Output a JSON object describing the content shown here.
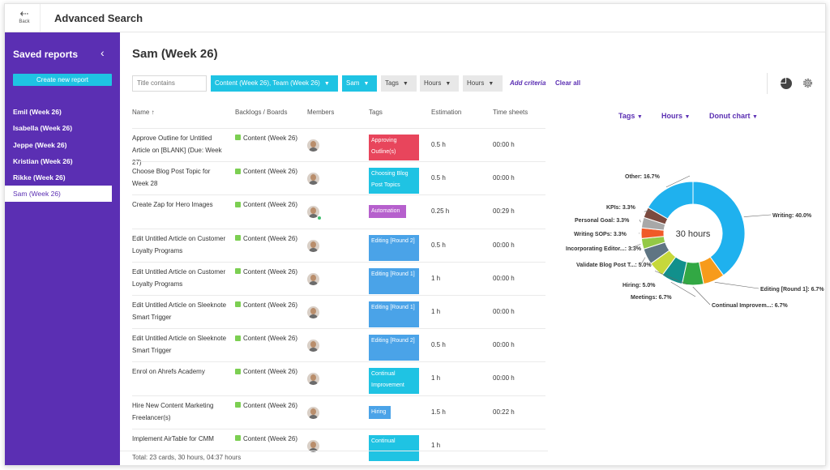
{
  "topbar": {
    "back_label": "Back",
    "title": "Advanced Search"
  },
  "sidebar": {
    "title": "Saved reports",
    "create_label": "Create new report",
    "items": [
      "Emil (Week 26)",
      "Isabella (Week 26)",
      "Jeppe (Week 26)",
      "Kristian (Week 26)",
      "Rikke (Week 26)",
      "Sam (Week 26)"
    ],
    "active_index": 5
  },
  "main": {
    "title": "Sam (Week 26)",
    "filters": {
      "title_placeholder": "Title contains",
      "boards": "Content (Week 26), Team (Week 26)",
      "member": "Sam",
      "tags": "Tags",
      "hours1": "Hours",
      "hours2": "Hours",
      "add_criteria": "Add criteria",
      "clear_all": "Clear all"
    },
    "columns": {
      "name": "Name ↑",
      "boards": "Backlogs / Boards",
      "members": "Members",
      "tags": "Tags",
      "estimation": "Estimation",
      "time": "Time sheets"
    },
    "rows": [
      {
        "name": "Approve Outline for Untitled Article on [BLANK] (Due: Week 27)",
        "board": "Content (Week 26)",
        "tag": "Approving Outline(s)",
        "tag_color": "#e8455c",
        "est": "0.5 h",
        "time": "00:00 h"
      },
      {
        "name": "Choose Blog Post Topic for Week 28",
        "board": "Content (Week 26)",
        "tag": "Choosing Blog Post Topics",
        "tag_color": "#1fc3e3",
        "est": "0.5 h",
        "time": "00:00 h"
      },
      {
        "name": "Create Zap for Hero Images",
        "board": "Content (Week 26)",
        "tag": "Automation",
        "tag_color": "#b660cd",
        "est": "0.25 h",
        "time": "00:29 h",
        "online": true
      },
      {
        "name": "Edit Untitled Article on Customer Loyalty Programs",
        "board": "Content (Week 26)",
        "tag": "Editing [Round 2]",
        "tag_color": "#4aa3e8",
        "est": "0.5 h",
        "time": "00:00 h"
      },
      {
        "name": "Edit Untitled Article on Customer Loyalty Programs",
        "board": "Content (Week 26)",
        "tag": "Editing [Round 1]",
        "tag_color": "#4aa3e8",
        "est": "1 h",
        "time": "00:00 h"
      },
      {
        "name": "Edit Untitled Article on Sleeknote Smart Trigger",
        "board": "Content (Week 26)",
        "tag": "Editing [Round 1]",
        "tag_color": "#4aa3e8",
        "est": "1 h",
        "time": "00:00 h"
      },
      {
        "name": "Edit Untitled Article on Sleeknote Smart Trigger",
        "board": "Content (Week 26)",
        "tag": "Editing [Round 2]",
        "tag_color": "#4aa3e8",
        "est": "0.5 h",
        "time": "00:00 h"
      },
      {
        "name": "Enrol on Ahrefs Academy",
        "board": "Content (Week 26)",
        "tag": "Continual Improvement",
        "tag_color": "#1fc3e3",
        "est": "1 h",
        "time": "00:00 h"
      },
      {
        "name": "Hire New Content Marketing Freelancer(s)",
        "board": "Content (Week 26)",
        "tag": "Hiring",
        "tag_color": "#4aa3e8",
        "est": "1.5 h",
        "time": "00:22 h"
      },
      {
        "name": "Implement AirTable for CMM",
        "board": "Content (Week 26)",
        "tag": "Continual",
        "tag_color": "#1fc3e3",
        "est": "1 h",
        "time": ""
      }
    ],
    "footer": "Total: 23 cards, 30 hours, 04:37 hours"
  },
  "chart_controls": {
    "tags": "Tags",
    "hours": "Hours",
    "type": "Donut chart"
  },
  "chart_data": {
    "type": "pie",
    "style": "donut",
    "center_label": "30 hours",
    "slices": [
      {
        "label": "Writing: 40.0%",
        "value": 40.0,
        "color": "#1fb1ee"
      },
      {
        "label": "Editing [Round 1]: 6.7%",
        "value": 6.7,
        "color": "#f79b1b"
      },
      {
        "label": "Continual Improvem...: 6.7%",
        "value": 6.7,
        "color": "#32a844"
      },
      {
        "label": "Meetings: 6.7%",
        "value": 6.7,
        "color": "#11908c"
      },
      {
        "label": "Hiring: 5.0%",
        "value": 5.0,
        "color": "#c6d83b"
      },
      {
        "label": "Validate Blog Post T...: 5.0%",
        "value": 5.0,
        "color": "#5f7583"
      },
      {
        "label": "Incorporating Editor...: 3.3%",
        "value": 3.3,
        "color": "#93c946"
      },
      {
        "label": "Writing SOPs: 3.3%",
        "value": 3.3,
        "color": "#f05a28"
      },
      {
        "label": "Personal Goal: 3.3%",
        "value": 3.3,
        "color": "#a8a8a8"
      },
      {
        "label": "KPIs: 3.3%",
        "value": 3.3,
        "color": "#7b4a3f"
      },
      {
        "label": "Other: 16.7%",
        "value": 16.7,
        "color": "#1fb1ee"
      }
    ]
  }
}
